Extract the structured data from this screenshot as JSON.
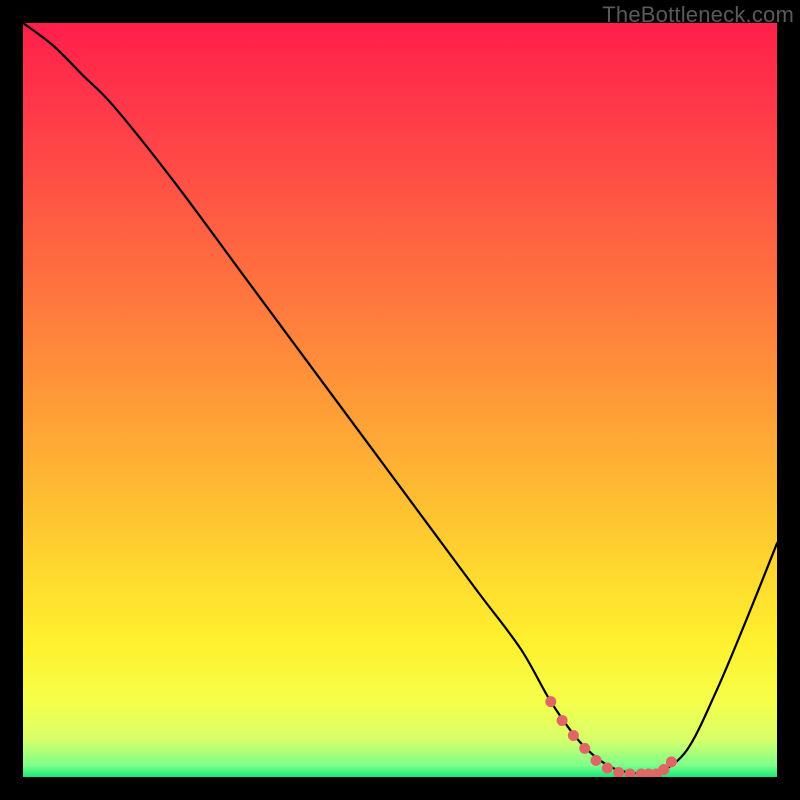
{
  "watermark": "TheBottleneck.com",
  "gradient": {
    "stops": [
      {
        "offset": 0.0,
        "color": "#ff1f4b"
      },
      {
        "offset": 0.12,
        "color": "#ff3a49"
      },
      {
        "offset": 0.25,
        "color": "#ff5a43"
      },
      {
        "offset": 0.38,
        "color": "#ff7a3e"
      },
      {
        "offset": 0.5,
        "color": "#ff9a38"
      },
      {
        "offset": 0.62,
        "color": "#ffba33"
      },
      {
        "offset": 0.72,
        "color": "#ffd62f"
      },
      {
        "offset": 0.82,
        "color": "#fff02e"
      },
      {
        "offset": 0.9,
        "color": "#f5ff4a"
      },
      {
        "offset": 0.95,
        "color": "#d8ff6a"
      },
      {
        "offset": 0.985,
        "color": "#7dff8a"
      },
      {
        "offset": 1.0,
        "color": "#17e87c"
      }
    ]
  },
  "chart_data": {
    "type": "line",
    "title": "",
    "xlabel": "",
    "ylabel": "",
    "xlim": [
      0,
      100
    ],
    "ylim": [
      0,
      100
    ],
    "series": [
      {
        "name": "curve",
        "x": [
          0,
          4,
          8,
          12,
          20,
          30,
          40,
          50,
          60,
          66,
          70,
          74,
          78,
          82,
          84,
          88,
          92,
          96,
          100
        ],
        "y": [
          100,
          97,
          93,
          89,
          79,
          65.5,
          52,
          38.5,
          25,
          17,
          10,
          4.5,
          1.3,
          0.4,
          0.4,
          3.5,
          11.5,
          21,
          31
        ]
      }
    ],
    "flat_segment": {
      "x_start": 70,
      "x_end": 86
    },
    "markers": {
      "color": "#e06666",
      "radius": 5.5,
      "points": [
        {
          "x": 70.0,
          "y": 10.0
        },
        {
          "x": 71.5,
          "y": 7.5
        },
        {
          "x": 73.0,
          "y": 5.5
        },
        {
          "x": 74.5,
          "y": 3.8
        },
        {
          "x": 76.0,
          "y": 2.2
        },
        {
          "x": 77.5,
          "y": 1.2
        },
        {
          "x": 79.0,
          "y": 0.6
        },
        {
          "x": 80.5,
          "y": 0.4
        },
        {
          "x": 82.0,
          "y": 0.4
        },
        {
          "x": 83.0,
          "y": 0.4
        },
        {
          "x": 84.0,
          "y": 0.4
        },
        {
          "x": 85.0,
          "y": 1.0
        },
        {
          "x": 86.0,
          "y": 2.0
        }
      ]
    }
  }
}
